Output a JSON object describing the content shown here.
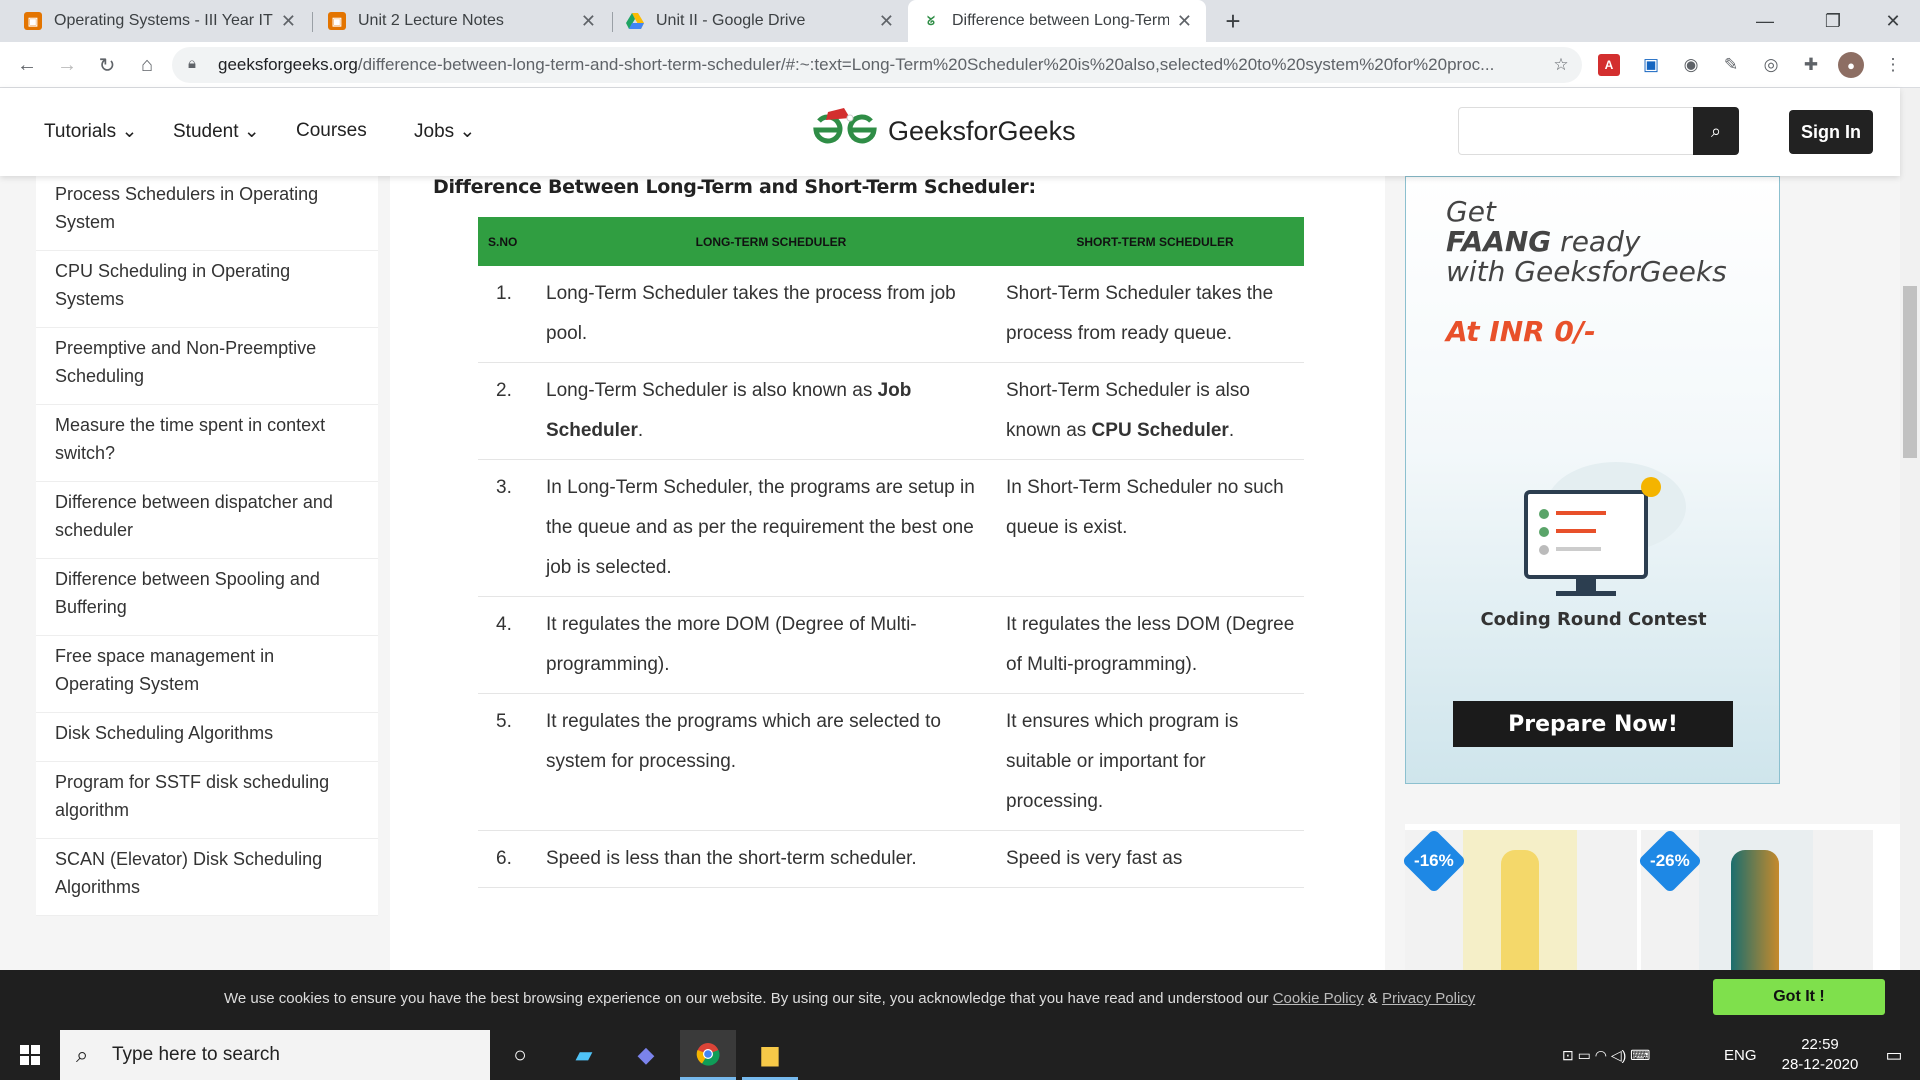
{
  "browser": {
    "tabs": [
      {
        "title": "Operating Systems - III Year IT (B",
        "favicon": "classroom",
        "color": "#f4b400"
      },
      {
        "title": "Unit 2 Lecture Notes",
        "favicon": "classroom",
        "color": "#f4b400"
      },
      {
        "title": "Unit II - Google Drive",
        "favicon": "drive",
        "color": "#1fa463"
      },
      {
        "title": "Difference between Long-Term a",
        "favicon": "gfg",
        "color": "#2f8d46"
      }
    ],
    "new_tab_symbol": "+",
    "url_host": "geeksforgeeks.org",
    "url_rest": "/difference-between-long-term-and-short-term-scheduler/#:~:text=Long-Term%20Scheduler%20is%20also,selected%20to%20system%20for%20proc..."
  },
  "site": {
    "nav": [
      "Tutorials",
      "Student",
      "Courses",
      "Jobs"
    ],
    "logo_text": "GeeksforGeeks",
    "search_placeholder": "",
    "signin_label": "Sign In"
  },
  "sidebar": {
    "items": [
      "Process Schedulers in Operating System",
      "CPU Scheduling in Operating Systems",
      "Preemptive and Non-Preemptive Scheduling",
      "Measure the time spent in context switch?",
      "Difference between dispatcher and scheduler",
      "Difference between Spooling and Buffering",
      "Free space management in Operating System",
      "Disk Scheduling Algorithms",
      "Program for SSTF disk scheduling algorithm",
      "SCAN (Elevator) Disk Scheduling Algorithms"
    ]
  },
  "article": {
    "heading": "Difference Between Long-Term and Short-Term Scheduler:",
    "columns": [
      "S.NO",
      "LONG-TERM SCHEDULER",
      "SHORT-TERM SCHEDULER"
    ],
    "rows": [
      {
        "no": "1.",
        "long": "Long-Term Scheduler takes the process from job pool.",
        "short": "Short-Term Scheduler takes the process from ready queue."
      },
      {
        "no": "2.",
        "long_pre": "Long-Term Scheduler is also known as ",
        "long_bold": "Job Scheduler",
        "long_post": ".",
        "short_pre": "Short-Term Scheduler is also known as ",
        "short_bold": "CPU Scheduler",
        "short_post": "."
      },
      {
        "no": "3.",
        "long": "In Long-Term Scheduler, the programs are setup in the queue and as per the requirement the best one job is selected.",
        "short": "In Short-Term Scheduler no such queue is exist."
      },
      {
        "no": "4.",
        "long": "It regulates the more DOM (Degree of Multi-programming).",
        "short": "It regulates the less DOM (Degree of Multi-programming)."
      },
      {
        "no": "5.",
        "long": "It regulates the programs which are selected to system for processing.",
        "short": "It ensures which program is suitable or important for processing."
      },
      {
        "no": "6.",
        "long": "Speed is less than the short-term scheduler.",
        "short": "Speed is very fast as"
      }
    ]
  },
  "ad": {
    "line1": "Get",
    "line2_bold": "FAANG",
    "line2_rest": " ready",
    "line3": "with GeeksforGeeks",
    "price": "At INR 0/-",
    "contest": "Coding Round Contest",
    "cta": "Prepare Now!",
    "discount1": "-16%",
    "discount2": "-26%"
  },
  "cookie": {
    "text": "We use cookies to ensure you have the best browsing experience on our website. By using our site, you acknowledge that you have read and understood our ",
    "cookie_policy": "Cookie Policy",
    "amp": " & ",
    "privacy_policy": "Privacy Policy",
    "button": "Got It !"
  },
  "taskbar": {
    "search_placeholder": "Type here to search",
    "lang": "ENG",
    "time": "22:59",
    "date": "28-12-2020"
  }
}
